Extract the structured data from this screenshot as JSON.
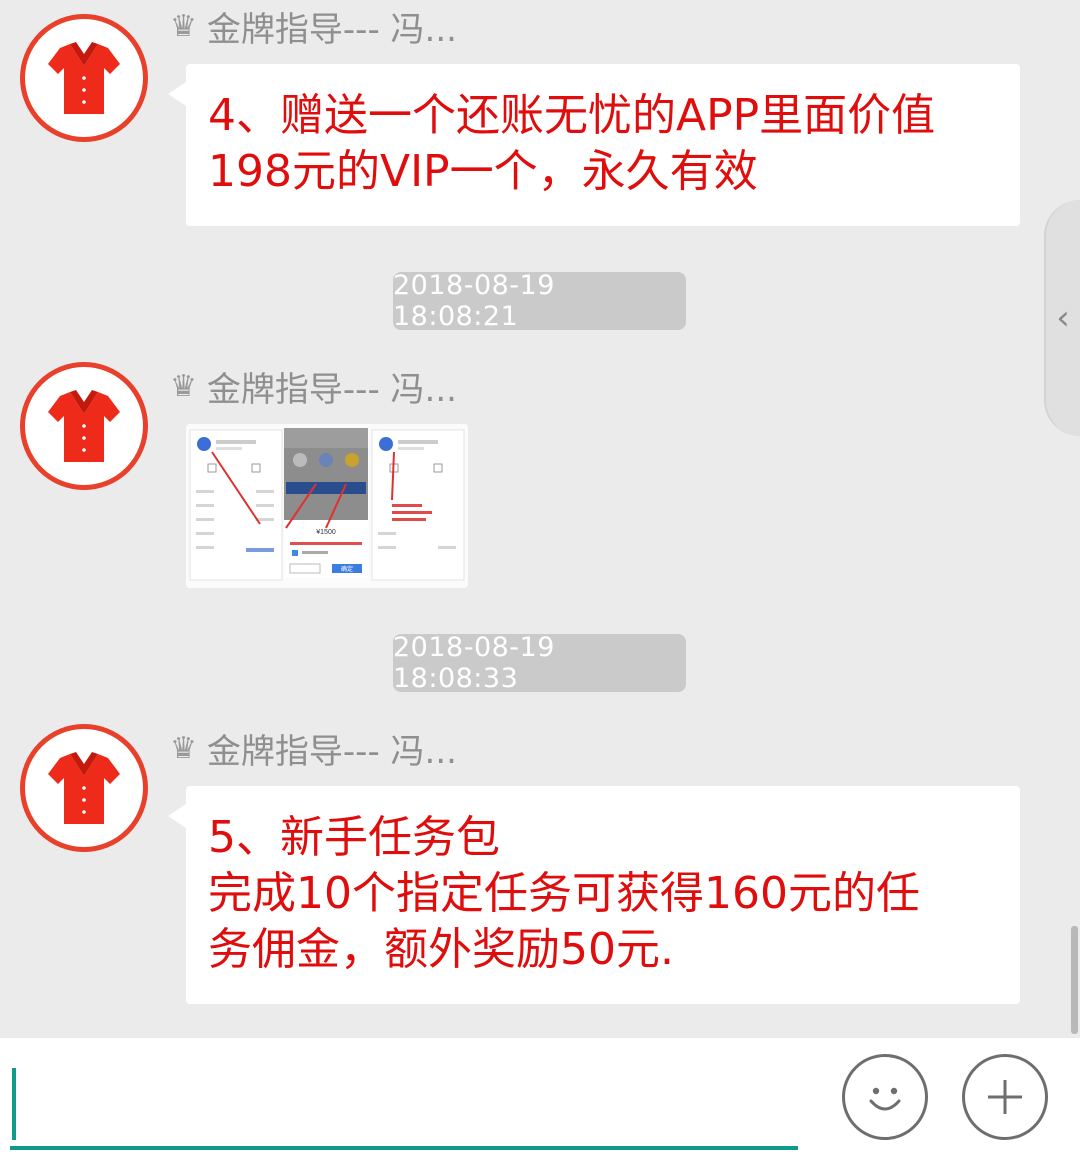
{
  "colors": {
    "accent_red": "#e00d0d",
    "avatar_border": "#e8402a",
    "input_underline": "#0f9a8a",
    "background": "#ebebeb"
  },
  "messages": [
    {
      "sender": "金牌指导--- 冯...",
      "avatar_icon": "red-shirt-avatar",
      "type": "text",
      "lines": [
        "4、赠送一个还账无忧的APP里面价值",
        "198元的VIP一个，永久有效"
      ]
    },
    {
      "timestamp": "2018-08-19 18:08:21"
    },
    {
      "sender": "金牌指导--- 冯...",
      "avatar_icon": "red-shirt-avatar",
      "type": "image"
    },
    {
      "timestamp": "2018-08-19 18:08:33"
    },
    {
      "sender": "金牌指导--- 冯...",
      "avatar_icon": "red-shirt-avatar",
      "type": "text",
      "lines": [
        "5、新手任务包",
        "完成10个指定任务可获得160元的任",
        "务佣金，额外奖励50元."
      ]
    }
  ],
  "thumbnail": {
    "amount_text": "¥1500",
    "button_label": "确定"
  },
  "side_tab_icon": "chevron-left-icon",
  "input_bar": {
    "value": "",
    "emoji_icon": "smiley-icon",
    "plus_icon": "plus-icon"
  }
}
